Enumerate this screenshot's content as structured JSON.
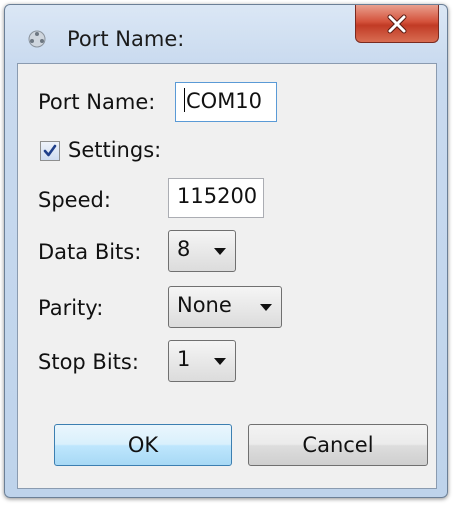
{
  "window": {
    "title": "Port Name:",
    "close_glyph": "X"
  },
  "form": {
    "port_name_label": "Port Name:",
    "port_name_value": "COM10",
    "settings_label": "Settings:",
    "settings_checked": true,
    "speed_label": "Speed:",
    "speed_value": "115200",
    "data_bits_label": "Data Bits:",
    "data_bits_value": "8",
    "parity_label": "Parity:",
    "parity_value": "None",
    "stop_bits_label": "Stop Bits:",
    "stop_bits_value": "1"
  },
  "buttons": {
    "ok": "OK",
    "cancel": "Cancel"
  },
  "colors": {
    "close_button": "#c94a33",
    "default_button_border": "#3c7fb1",
    "focus_border": "#5a9ad6"
  },
  "icons": {
    "app": "serial-port-icon",
    "close": "close-icon",
    "check": "checkmark-icon",
    "dropdown": "chevron-down-icon"
  }
}
